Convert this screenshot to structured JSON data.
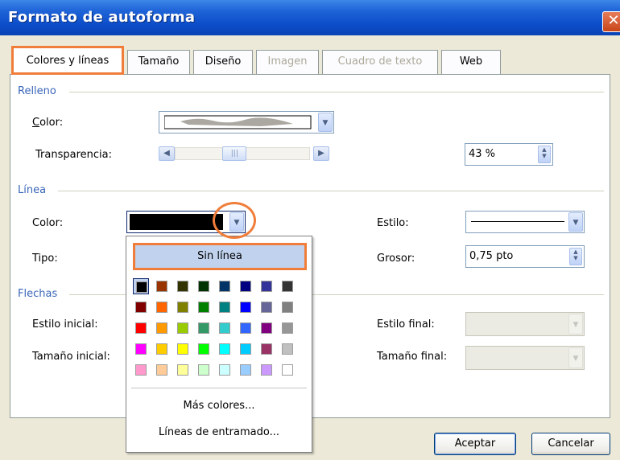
{
  "window": {
    "title": "Formato de autoforma",
    "close_glyph": "✕"
  },
  "tabs": [
    {
      "label": "Colores y líneas",
      "active": true,
      "enabled": true
    },
    {
      "label": "Tamaño",
      "active": false,
      "enabled": true
    },
    {
      "label": "Diseño",
      "active": false,
      "enabled": true
    },
    {
      "label": "Imagen",
      "active": false,
      "enabled": false
    },
    {
      "label": "Cuadro de texto",
      "active": false,
      "enabled": false
    },
    {
      "label": "Web",
      "active": false,
      "enabled": true
    }
  ],
  "relleno": {
    "heading": "Relleno",
    "color_label": "Color:",
    "transparencia_label": "Transparencia:",
    "transparencia_value": "43 %",
    "transparencia_fraction": 0.43
  },
  "linea": {
    "heading": "Línea",
    "color_label": "Color:",
    "color_value": "#000000",
    "tipo_label": "Tipo:",
    "estilo_label": "Estilo:",
    "grosor_label": "Grosor:",
    "grosor_value": "0,75 pto"
  },
  "flechas": {
    "heading": "Flechas",
    "estilo_inicial_label": "Estilo inicial:",
    "tamano_inicial_label": "Tamaño inicial:",
    "estilo_final_label": "Estilo final:",
    "tamano_final_label": "Tamaño final:"
  },
  "color_popup": {
    "no_line_label": "Sin línea",
    "swatches": [
      [
        "#000000",
        "#993300",
        "#333300",
        "#003300",
        "#003366",
        "#000080",
        "#333399",
        "#333333"
      ],
      [
        "#800000",
        "#FF6600",
        "#808000",
        "#008000",
        "#008080",
        "#0000FF",
        "#666699",
        "#808080"
      ],
      [
        "#FF0000",
        "#FF9900",
        "#99CC00",
        "#339966",
        "#33CCCC",
        "#3366FF",
        "#800080",
        "#969696"
      ],
      [
        "#FF00FF",
        "#FFCC00",
        "#FFFF00",
        "#00FF00",
        "#00FFFF",
        "#00CCFF",
        "#993366",
        "#C0C0C0"
      ],
      [
        "#FF99CC",
        "#FFCC99",
        "#FFFF99",
        "#CCFFCC",
        "#CCFFFF",
        "#99CCFF",
        "#CC99FF",
        "#FFFFFF"
      ]
    ],
    "more_colors_label": "Más colores...",
    "patterned_lines_label": "Líneas de entramado..."
  },
  "buttons": {
    "accept": "Aceptar",
    "cancel": "Cancelar"
  },
  "accent_color": "#F07D3A",
  "icons": [
    "close-icon",
    "dropdown-arrow-icon",
    "spin-arrows-icon",
    "scroll-left-icon",
    "scroll-right-icon"
  ]
}
